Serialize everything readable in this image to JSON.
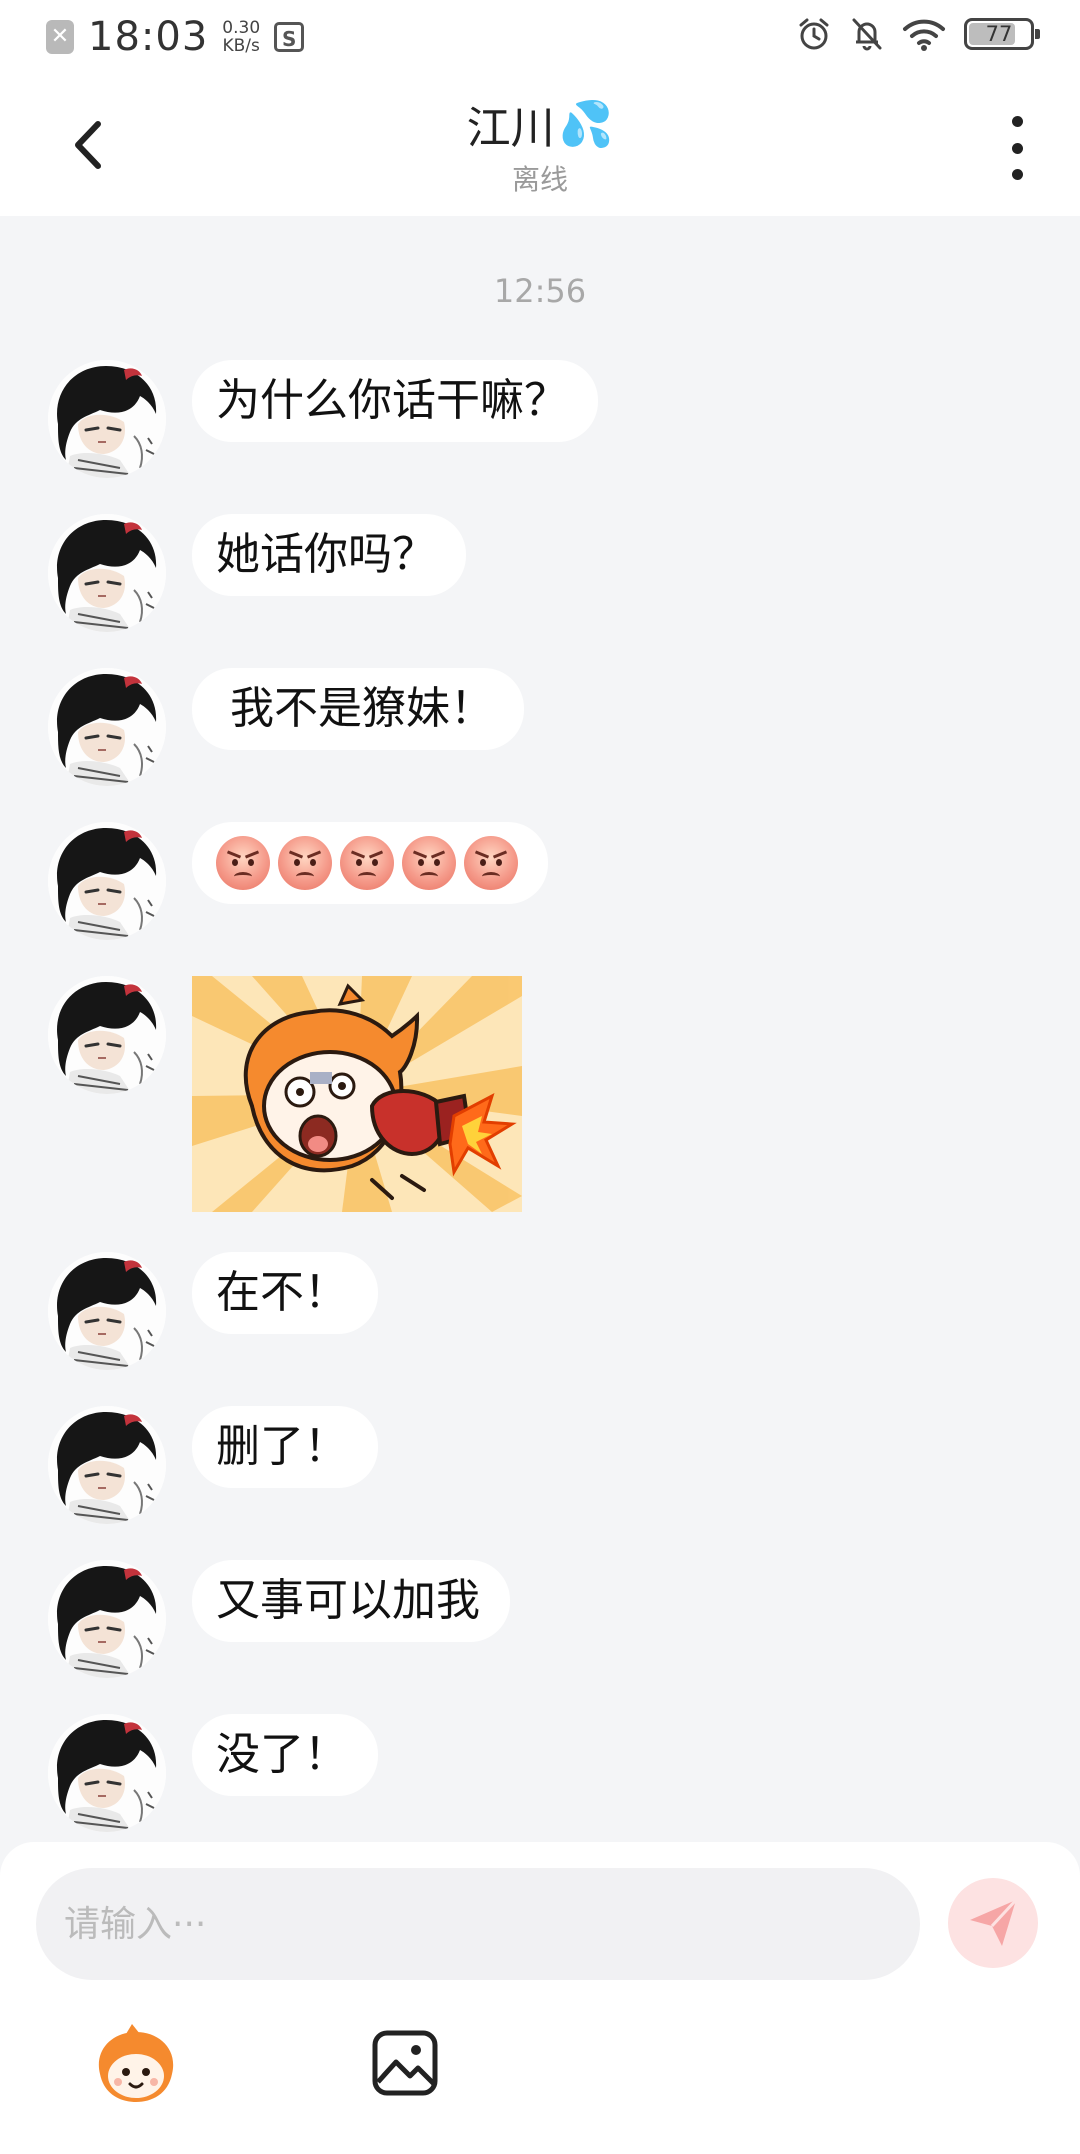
{
  "status_bar": {
    "time": "18:03",
    "net_speed_value": "0.30",
    "net_speed_unit": "KB/s",
    "battery": "77",
    "battery_level": 0.77
  },
  "header": {
    "title": "江川",
    "title_emoji": "💦",
    "subtitle": "离线"
  },
  "chat": {
    "timestamp": "12:56",
    "messages": [
      {
        "type": "text",
        "text": "为什么你话干嘛？"
      },
      {
        "type": "text",
        "text": "她话你吗？"
      },
      {
        "type": "text",
        "text": " 我不是獠妹！"
      },
      {
        "type": "emoji",
        "emoji": "angry-face",
        "count": 5
      },
      {
        "type": "sticker",
        "sticker": "angry-orange-character-punching"
      },
      {
        "type": "text",
        "text": "在不！"
      },
      {
        "type": "text",
        "text": "删了！"
      },
      {
        "type": "text",
        "text": "又事可以加我"
      },
      {
        "type": "text",
        "text": "没了！"
      }
    ]
  },
  "input": {
    "placeholder": "请输入···",
    "value": ""
  },
  "colors": {
    "chat_background": "#f4f5f7",
    "bubble": "#ffffff",
    "send_button": "#fde2e2",
    "send_icon": "#f6a6a6"
  }
}
